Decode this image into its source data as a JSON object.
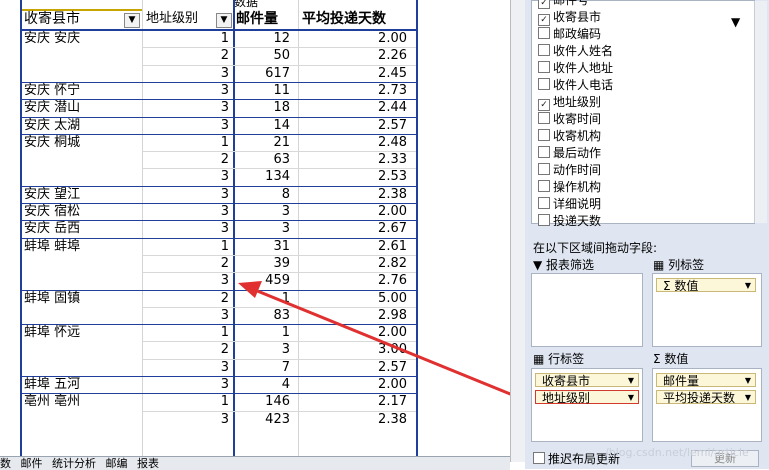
{
  "pivot": {
    "data_caption": "数据",
    "headers": [
      "收寄县市",
      "地址级别",
      "邮件量",
      "平均投递天数"
    ],
    "rows": [
      {
        "city": "安庆 安庆",
        "level": "1",
        "qty": "12",
        "days": "2.00"
      },
      {
        "city": "",
        "level": "2",
        "qty": "50",
        "days": "2.26"
      },
      {
        "city": "",
        "level": "3",
        "qty": "617",
        "days": "2.45"
      },
      {
        "city": "安庆 怀宁",
        "level": "3",
        "qty": "11",
        "days": "2.73"
      },
      {
        "city": "安庆 潜山",
        "level": "3",
        "qty": "18",
        "days": "2.44"
      },
      {
        "city": "安庆 太湖",
        "level": "3",
        "qty": "14",
        "days": "2.57"
      },
      {
        "city": "安庆 桐城",
        "level": "1",
        "qty": "21",
        "days": "2.48"
      },
      {
        "city": "",
        "level": "2",
        "qty": "63",
        "days": "2.33"
      },
      {
        "city": "",
        "level": "3",
        "qty": "134",
        "days": "2.53"
      },
      {
        "city": "安庆 望江",
        "level": "3",
        "qty": "8",
        "days": "2.38"
      },
      {
        "city": "安庆 宿松",
        "level": "3",
        "qty": "3",
        "days": "2.00"
      },
      {
        "city": "安庆 岳西",
        "level": "3",
        "qty": "3",
        "days": "2.67"
      },
      {
        "city": "蚌埠 蚌埠",
        "level": "1",
        "qty": "31",
        "days": "2.61"
      },
      {
        "city": "",
        "level": "2",
        "qty": "39",
        "days": "2.82"
      },
      {
        "city": "",
        "level": "3",
        "qty": "459",
        "days": "2.76"
      },
      {
        "city": "蚌埠 固镇",
        "level": "2",
        "qty": "1",
        "days": "5.00"
      },
      {
        "city": "",
        "level": "3",
        "qty": "83",
        "days": "2.98"
      },
      {
        "city": "蚌埠 怀远",
        "level": "1",
        "qty": "1",
        "days": "2.00"
      },
      {
        "city": "",
        "level": "2",
        "qty": "3",
        "days": "3.00"
      },
      {
        "city": "",
        "level": "3",
        "qty": "7",
        "days": "2.57"
      },
      {
        "city": "蚌埠 五河",
        "level": "3",
        "qty": "4",
        "days": "2.00"
      },
      {
        "city": "亳州 亳州",
        "level": "1",
        "qty": "146",
        "days": "2.17"
      },
      {
        "city": "",
        "level": "3",
        "qty": "423",
        "days": "2.38"
      }
    ]
  },
  "sheet_tabs": [
    "数",
    "邮件",
    "统计分析",
    "邮编",
    "报表"
  ],
  "field_list": [
    {
      "label": "邮件号",
      "checked": true
    },
    {
      "label": "收寄县市",
      "checked": true
    },
    {
      "label": "邮政编码",
      "checked": false
    },
    {
      "label": "收件人姓名",
      "checked": false
    },
    {
      "label": "收件人地址",
      "checked": false
    },
    {
      "label": "收件人电话",
      "checked": false
    },
    {
      "label": "地址级别",
      "checked": true
    },
    {
      "label": "收寄时间",
      "checked": false
    },
    {
      "label": "收寄机构",
      "checked": false
    },
    {
      "label": "最后动作",
      "checked": false
    },
    {
      "label": "动作时间",
      "checked": false
    },
    {
      "label": "操作机构",
      "checked": false
    },
    {
      "label": "详细说明",
      "checked": false
    },
    {
      "label": "投递天数",
      "checked": false
    }
  ],
  "areas": {
    "drag_hint": "在以下区域间拖动字段:",
    "report_filter": "报表筛选",
    "column_labels": "列标签",
    "row_labels": "行标签",
    "values": "数值",
    "column_chip": "Σ 数值",
    "row_chips": [
      "收寄县市",
      "地址级别"
    ],
    "value_chips": [
      "邮件量",
      "平均投递天数"
    ]
  },
  "defer_update_label": "推迟布局更新",
  "update_button": "更新",
  "watermark": "/blog.csdn.net/lemi/article"
}
